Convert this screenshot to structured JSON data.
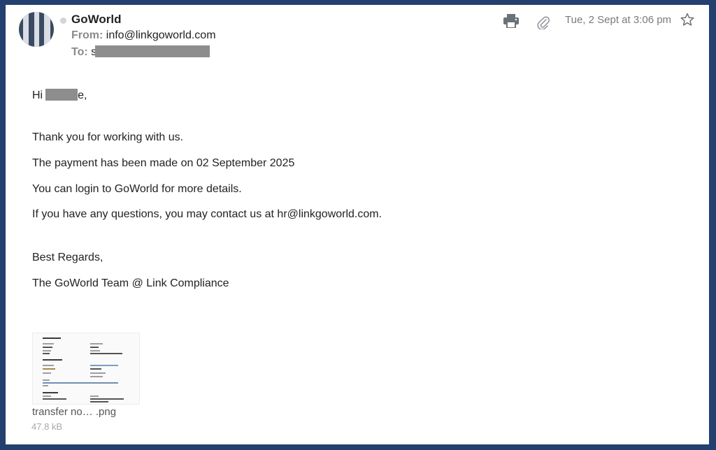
{
  "header": {
    "sender_name": "GoWorld",
    "from_label": "From:",
    "from_value": "info@linkgoworld.com",
    "to_label": "To:",
    "to_value_visible": "s",
    "date": "Tue, 2 Sept at 3:06 pm"
  },
  "icons": {
    "print": "printer-icon",
    "attachment": "paperclip-icon",
    "star": "star-icon"
  },
  "body": {
    "greeting_prefix": "Hi",
    "greeting_suffix": "e,",
    "lines": [
      "Thank you for working with us.",
      "The payment has been made on 02 September 2025",
      "You can login to GoWorld for more details.",
      "If you have any questions, you may contact us at hr@linkgoworld.com."
    ],
    "signoff": "Best Regards,",
    "signature": "The GoWorld Team @ Link Compliance"
  },
  "attachment": {
    "name": "transfer no… .png",
    "size": "47.8 kB"
  },
  "colors": {
    "frame": "#24406f",
    "text": "#222222",
    "muted": "#8a8a8a"
  }
}
